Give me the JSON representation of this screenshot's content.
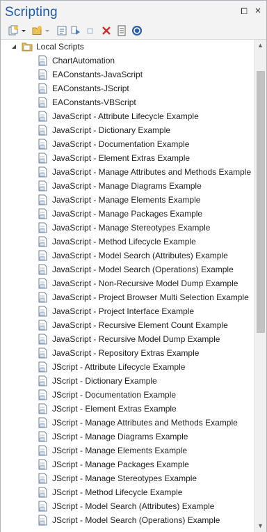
{
  "window": {
    "title": "Scripting",
    "pin_label": "⧠",
    "close_label": "×"
  },
  "toolbar": {
    "tools": [
      "new-script-icon",
      "dropdown-arrow-icon",
      "new-group-icon",
      "refresh-icon",
      "run-icon",
      "stop-icon",
      "delete-icon",
      "properties-icon",
      "help-icon"
    ]
  },
  "tree": {
    "root_label": "Local Scripts",
    "items": [
      "ChartAutomation",
      "EAConstants-JavaScript",
      "EAConstants-JScript",
      "EAConstants-VBScript",
      "JavaScript - Attribute Lifecycle Example",
      "JavaScript - Dictionary Example",
      "JavaScript - Documentation Example",
      "JavaScript - Element Extras Example",
      "JavaScript - Manage Attributes and Methods Example",
      "JavaScript - Manage Diagrams Example",
      "JavaScript - Manage Elements Example",
      "JavaScript - Manage Packages Example",
      "JavaScript - Manage Stereotypes Example",
      "JavaScript - Method Lifecycle Example",
      "JavaScript - Model Search (Attributes) Example",
      "JavaScript - Model Search (Operations) Example",
      "JavaScript - Non-Recursive Model Dump Example",
      "JavaScript - Project Browser Multi Selection Example",
      "JavaScript - Project Interface Example",
      "JavaScript - Recursive Element Count Example",
      "JavaScript - Recursive Model Dump Example",
      "JavaScript - Repository Extras Example",
      "JScript - Attribute Lifecycle Example",
      "JScript - Dictionary Example",
      "JScript - Documentation Example",
      "JScript - Element Extras Example",
      "JScript - Manage Attributes and Methods Example",
      "JScript - Manage Diagrams Example",
      "JScript - Manage Elements Example",
      "JScript - Manage Packages Example",
      "JScript - Manage Stereotypes Example",
      "JScript - Method Lifecycle Example",
      "JScript - Model Search (Attributes) Example",
      "JScript - Model Search (Operations) Example"
    ]
  },
  "scrollbar": {
    "up_arrow": "▲",
    "down_arrow": "▼"
  },
  "colors": {
    "title": "#1e5aa8",
    "folder": "#e8c15a",
    "doc_border": "#6a7f9a",
    "delete": "#d22d2d",
    "help": "#2a5db0"
  }
}
